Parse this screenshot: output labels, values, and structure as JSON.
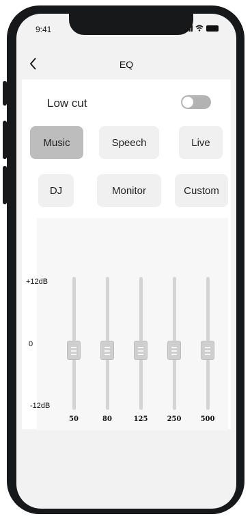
{
  "status_bar": {
    "time": "9:41"
  },
  "nav": {
    "title": "EQ"
  },
  "low_cut": {
    "label": "Low cut",
    "enabled": false
  },
  "presets": [
    {
      "label": "Music",
      "selected": true
    },
    {
      "label": "Speech",
      "selected": false
    },
    {
      "label": "Live",
      "selected": false
    },
    {
      "label": "DJ",
      "selected": false
    },
    {
      "label": "Monitor",
      "selected": false
    },
    {
      "label": "Custom",
      "selected": false
    }
  ],
  "eq": {
    "scale_max_label": "+12dB",
    "scale_mid_label": "0",
    "scale_min_label": "-12dB",
    "range_db": [
      -12,
      12
    ],
    "bands": [
      {
        "freq": "50",
        "gain_db": 0
      },
      {
        "freq": "80",
        "gain_db": 0
      },
      {
        "freq": "125",
        "gain_db": 0
      },
      {
        "freq": "250",
        "gain_db": 0
      },
      {
        "freq": "500",
        "gain_db": 0
      }
    ]
  }
}
